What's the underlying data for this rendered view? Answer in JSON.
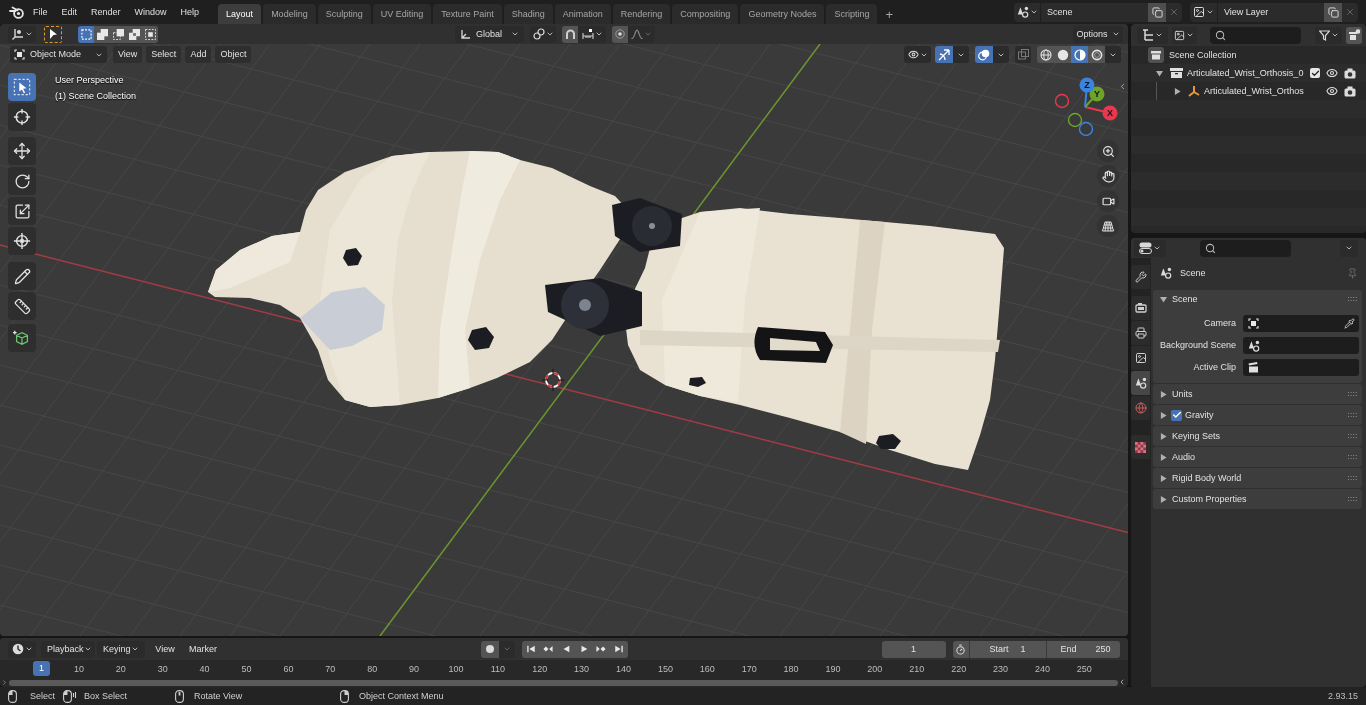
{
  "topbar": {
    "menus": [
      "File",
      "Edit",
      "Render",
      "Window",
      "Help"
    ],
    "workspaces": [
      {
        "label": "Layout",
        "selected": true
      },
      {
        "label": "Modeling",
        "selected": false
      },
      {
        "label": "Sculpting",
        "selected": false
      },
      {
        "label": "UV Editing",
        "selected": false
      },
      {
        "label": "Texture Paint",
        "selected": false
      },
      {
        "label": "Shading",
        "selected": false
      },
      {
        "label": "Animation",
        "selected": false
      },
      {
        "label": "Rendering",
        "selected": false
      },
      {
        "label": "Compositing",
        "selected": false
      },
      {
        "label": "Geometry Nodes",
        "selected": false
      },
      {
        "label": "Scripting",
        "selected": false
      }
    ],
    "add_workspace": "+",
    "scene": "Scene",
    "view_layer": "View Layer"
  },
  "viewport": {
    "tool_header": {
      "select_modes": [
        {
          "kind": "new",
          "selected": true
        },
        {
          "kind": "extend",
          "selected": false
        },
        {
          "kind": "subtract",
          "selected": false
        },
        {
          "kind": "difference",
          "selected": false
        },
        {
          "kind": "intersect",
          "selected": false
        }
      ],
      "orientation": "Global",
      "snap_on": false,
      "proportional_on": false,
      "options": "Options"
    },
    "header": {
      "mode": "Object Mode",
      "menus": [
        "View",
        "Select",
        "Add",
        "Object"
      ],
      "gizmos_on": true,
      "overlays_on": true,
      "xray_on": false,
      "shading": [
        {
          "kind": "wireframe",
          "selected": false
        },
        {
          "kind": "solid",
          "selected": false
        },
        {
          "kind": "material",
          "selected": true
        },
        {
          "kind": "rendered",
          "selected": false
        }
      ]
    },
    "toolbar": [
      [
        {
          "kind": "select_box",
          "selected": true
        },
        {
          "kind": "cursor",
          "selected": false
        }
      ],
      [
        {
          "kind": "move",
          "selected": false
        },
        {
          "kind": "rotate",
          "selected": false
        },
        {
          "kind": "scale",
          "selected": false
        },
        {
          "kind": "transform",
          "selected": false
        }
      ],
      [
        {
          "kind": "annotate",
          "selected": false
        },
        {
          "kind": "measure",
          "selected": false
        }
      ],
      [
        {
          "kind": "add_cube",
          "selected": false
        }
      ]
    ],
    "view_name": "User Perspective",
    "collection_info": "(1) Scene Collection",
    "gizmo": {
      "axes": [
        {
          "label": "X",
          "color": "#e8384f"
        },
        {
          "label": "Y",
          "color": "#6ca42a"
        },
        {
          "label": "Z",
          "color": "#3b83e0"
        }
      ]
    }
  },
  "timeline": {
    "menus": [
      {
        "label": "Playback",
        "kind": "dropdown"
      },
      {
        "label": "Keying",
        "kind": "dropdown"
      },
      {
        "label": "View",
        "kind": "menu"
      },
      {
        "label": "Marker",
        "kind": "menu"
      }
    ],
    "auto_keying": false,
    "current_frame": "1",
    "start_label": "Start",
    "start": "1",
    "end_label": "End",
    "end": "250",
    "playhead": "1",
    "ruler": [
      "10",
      "20",
      "30",
      "40",
      "50",
      "60",
      "70",
      "80",
      "90",
      "100",
      "110",
      "120",
      "130",
      "140",
      "150",
      "160",
      "170",
      "180",
      "190",
      "200",
      "210",
      "220",
      "230",
      "240",
      "250"
    ]
  },
  "outliner": {
    "tree": [
      {
        "name": "Scene Collection",
        "kind": "scene_collection",
        "children": [
          {
            "name": "Articulated_Wrist_Orthosis_0",
            "kind": "collection",
            "expanded": true,
            "checked": true,
            "children": [
              {
                "name": "Articulated_Wrist_Orthos",
                "kind": "empty",
                "expanded": false
              }
            ]
          }
        ]
      }
    ]
  },
  "properties": {
    "tabs": [
      [
        {
          "kind": "tool",
          "selected": false
        }
      ],
      [
        {
          "kind": "render",
          "selected": false
        },
        {
          "kind": "output",
          "selected": false
        },
        {
          "kind": "view_layer",
          "selected": false
        },
        {
          "kind": "scene",
          "selected": true
        },
        {
          "kind": "world",
          "selected": false
        }
      ],
      [
        {
          "kind": "texture",
          "selected": false
        }
      ]
    ],
    "context": "Scene",
    "panels": [
      {
        "title": "Scene",
        "kind": "plain",
        "expanded": true,
        "fields": [
          {
            "label": "Camera",
            "kind": "camera"
          },
          {
            "label": "Background Scene",
            "kind": "scene"
          },
          {
            "label": "Active Clip",
            "kind": "clip"
          }
        ]
      },
      {
        "title": "Units",
        "kind": "plain",
        "expanded": false
      },
      {
        "title": "Gravity",
        "kind": "toggle",
        "checked": true,
        "expanded": false
      },
      {
        "title": "Keying Sets",
        "kind": "plain",
        "expanded": false
      },
      {
        "title": "Audio",
        "kind": "plain",
        "expanded": false
      },
      {
        "title": "Rigid Body World",
        "kind": "plain",
        "expanded": false
      },
      {
        "title": "Custom Properties",
        "kind": "plain",
        "expanded": false
      }
    ]
  },
  "status_bar": {
    "hints": [
      {
        "kind": "left_click",
        "label": "Select"
      },
      {
        "kind": "left_drag",
        "label": "Box Select"
      },
      {
        "kind": "middle_drag",
        "label": "Rotate View"
      },
      {
        "kind": "right_click",
        "label": "Object Context Menu"
      }
    ],
    "version": "2.93.15"
  }
}
